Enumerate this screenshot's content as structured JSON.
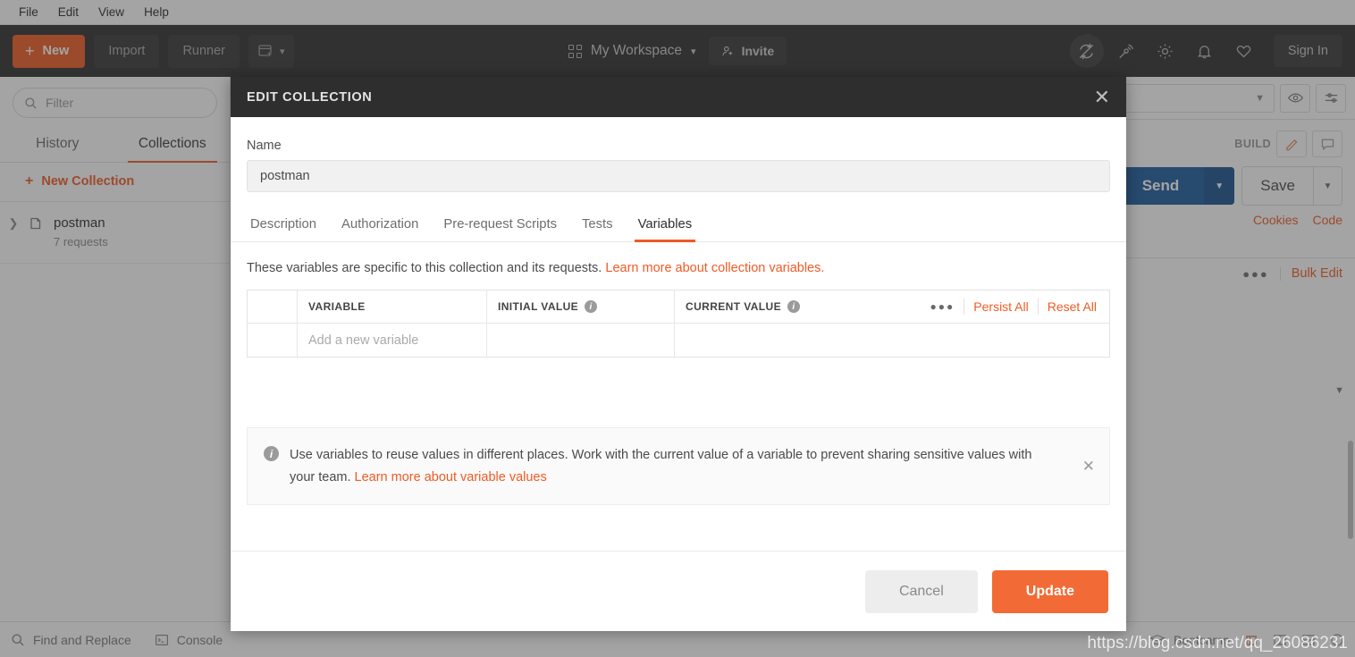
{
  "menubar": {
    "items": [
      "File",
      "Edit",
      "View",
      "Help"
    ]
  },
  "toolbar": {
    "new_label": "New",
    "import_label": "Import",
    "runner_label": "Runner",
    "new_tab_icon": "new-tab-icon",
    "workspace_label": "My Workspace",
    "invite_label": "Invite",
    "sign_in_label": "Sign In",
    "icons": [
      "sync-off-icon",
      "satellite-icon",
      "gear-icon",
      "bell-icon",
      "heart-icon"
    ]
  },
  "sidebar": {
    "filter_placeholder": "Filter",
    "tabs": [
      {
        "label": "History",
        "selected": false
      },
      {
        "label": "Collections",
        "selected": true
      }
    ],
    "new_collection_label": "New Collection",
    "collections": [
      {
        "name": "postman",
        "requests": "7 requests"
      }
    ]
  },
  "main": {
    "environment_placeholder": "",
    "build_label": "BUILD",
    "send_label": "Send",
    "save_label": "Save",
    "cookies_label": "Cookies",
    "code_label": "Code",
    "bulk_edit_label": "Bulk Edit"
  },
  "statusbar": {
    "find_replace_label": "Find and Replace",
    "console_label": "Console",
    "bootcamp_label": "Bootcamp"
  },
  "modal": {
    "title": "EDIT COLLECTION",
    "close_icon": "close-icon",
    "name_label": "Name",
    "name_value": "postman",
    "tabs": [
      {
        "label": "Description",
        "selected": false
      },
      {
        "label": "Authorization",
        "selected": false
      },
      {
        "label": "Pre-request Scripts",
        "selected": false
      },
      {
        "label": "Tests",
        "selected": false
      },
      {
        "label": "Variables",
        "selected": true
      }
    ],
    "description_text": "These variables are specific to this collection and its requests. ",
    "description_link": "Learn more about collection variables.",
    "table": {
      "headers": [
        "",
        "VARIABLE",
        "INITIAL VALUE",
        "CURRENT VALUE"
      ],
      "more_icon": "more-options-icon",
      "persist_all_label": "Persist All",
      "reset_all_label": "Reset All",
      "rows": [
        {
          "variable": "Add a new variable",
          "initial_value": "",
          "current_value": ""
        }
      ]
    },
    "note": {
      "text": "Use variables to reuse values in different places. Work with the current value of a variable to prevent sharing sensitive values with your team. ",
      "link": "Learn more about variable values",
      "close_icon": "close-icon"
    },
    "cancel_label": "Cancel",
    "update_label": "Update"
  },
  "watermark": {
    "text": "https://blog.csdn.net/qq_26086231"
  },
  "colors": {
    "accent_orange": "#ef5b25",
    "update_orange": "#f26a35",
    "dark_bar": "#2e2e2e",
    "send_blue": "#1c5b9e"
  }
}
